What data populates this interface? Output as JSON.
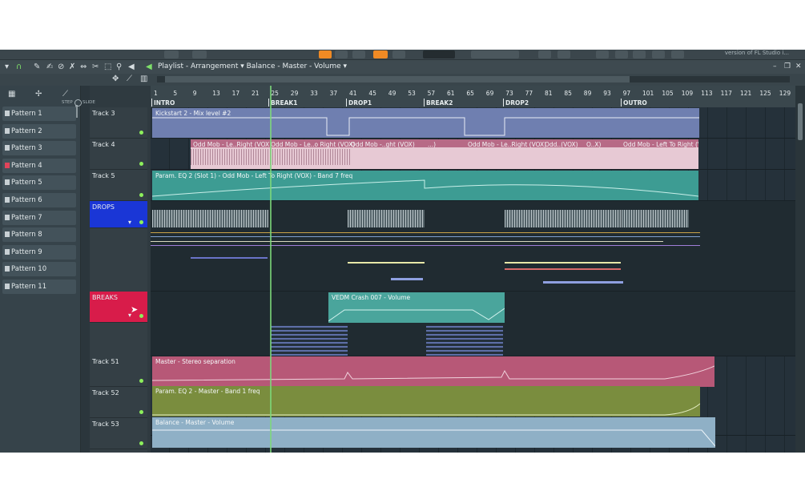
{
  "window": {
    "version_text": "version of FL Studio i...",
    "title_parts": [
      "Playlist",
      "Arrangement",
      "Balance",
      "Master",
      "Volume"
    ],
    "title": "Playlist - Arrangement ▾ Balance - Master - Volume ▾",
    "controls": [
      "–",
      "❐",
      "✕"
    ]
  },
  "picker": {
    "step_label": "STEP",
    "slide_label": "SLIDE",
    "patterns": [
      "Pattern 1",
      "Pattern 2",
      "Pattern 3",
      "Pattern 4",
      "Pattern 5",
      "Pattern 6",
      "Pattern 7",
      "Pattern 8",
      "Pattern 9",
      "Pattern 10",
      "Pattern 11"
    ],
    "highlight_index": 3
  },
  "ruler": {
    "bars": [
      "1",
      "5",
      "9",
      "13",
      "17",
      "21",
      "25",
      "29",
      "33",
      "37",
      "41",
      "45",
      "49",
      "53",
      "57",
      "61",
      "65",
      "69",
      "73",
      "77",
      "81",
      "85",
      "89",
      "93",
      "97",
      "101",
      "105",
      "109",
      "113",
      "117",
      "121",
      "125",
      "129"
    ],
    "markers": [
      "INTRO",
      "BREAK1",
      "DROP1",
      "BREAK2",
      "DROP2",
      "OUTRO"
    ]
  },
  "tracks": [
    {
      "name": "Track 3"
    },
    {
      "name": "Track 4"
    },
    {
      "name": "Track 5"
    },
    {
      "name": "DROPS"
    },
    {
      "name": "BREAKS"
    },
    {
      "name": "Track 51"
    },
    {
      "name": "Track 52"
    },
    {
      "name": "Track 53"
    }
  ],
  "clips": {
    "kickstart": "Kickstart 2 - Mix level #2",
    "vox1": "Odd Mob - Le..Right (VOX)",
    "vox2": "Odd Mob - Le..o Right (VOX)",
    "vox3": "Odd Mob -..ght (VOX)",
    "vox4": "...)",
    "vox5": "Odd Mob - Le..Right (VOX)",
    "vox6": "Odd..(VOX)",
    "vox7": "O..X)",
    "vox8": "Odd Mob - Left To Right (VOX)",
    "eq": "Param. EQ 2 (Slot 1) - Odd Mob - Left To Right (VOX) - Band 7 freq",
    "crash": "VEDM Crash 007 - Volume",
    "stereo": "Master - Stereo separation",
    "eq_master": "Param. EQ 2 - Master - Band 1 freq",
    "balance": "Balance - Master - Volume"
  },
  "colors": {
    "kick": "#6f7fb0",
    "vox": "#e7c9d4",
    "eq": "#3d9c93",
    "drops": "#1a36d6",
    "breaks": "#d81c4a",
    "crash": "#4aa59c",
    "stereo": "#b75877",
    "eqm": "#7a8d3e",
    "balance": "#8fb0c6"
  }
}
